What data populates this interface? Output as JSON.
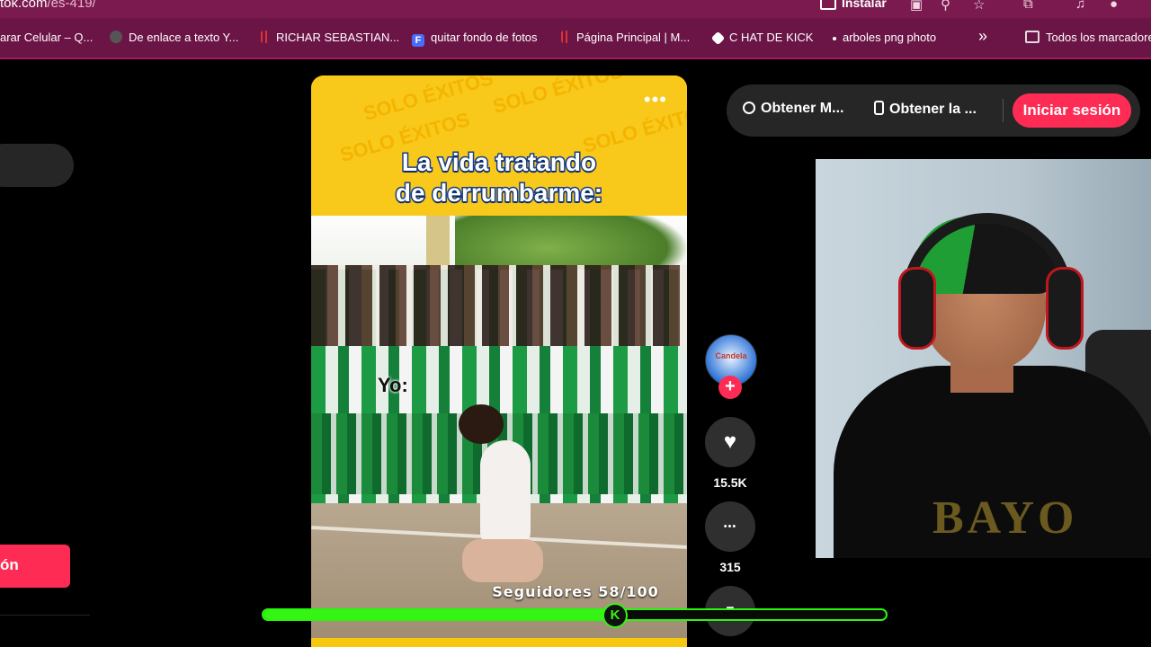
{
  "browser": {
    "url_domain": "tok.com",
    "url_path": "/es-419/",
    "install_label": "Instalar"
  },
  "bookmarks": [
    {
      "label": "arar Celular – Q...",
      "icon": "none"
    },
    {
      "label": "De enlace a texto Y...",
      "icon": "gear-icon"
    },
    {
      "label": "RICHAR SEBASTIAN...",
      "icon": "bars-icon"
    },
    {
      "label": "quitar fondo de fotos",
      "icon": "f-icon"
    },
    {
      "label": "Página Principal | M...",
      "icon": "bars-icon"
    },
    {
      "label": "C HAT DE KICK",
      "icon": "kick-icon"
    },
    {
      "label": "arboles png photo",
      "icon": "dot-icon"
    },
    {
      "label": "Todos los marcadores",
      "icon": "folder-icon"
    }
  ],
  "bookmarks_more": "»",
  "left": {
    "login_fragment": "ón"
  },
  "video": {
    "caption_line1": "La vida tratando",
    "caption_line2": "de derrumbarme:",
    "overlay_label": "Yo:",
    "watermark": "SOLO ÉXITOS",
    "menu_dots": "•••"
  },
  "actions": {
    "avatar_text": "Candela",
    "follow_symbol": "+",
    "likes": "15.5K",
    "comments": "315",
    "like_symbol": "♥",
    "comment_symbol": "•••",
    "saves_symbol": "■"
  },
  "topbar": {
    "get_music": "Obtener M...",
    "get_app": "Obtener la ...",
    "login": "Iniciar sesión"
  },
  "webcam": {
    "shirt_text": "BAYO"
  },
  "overlay": {
    "followers_label": "Seguidores 58/100",
    "followers_progress": 0.58,
    "badge_letter": "K",
    "accent_color": "#35f514"
  },
  "colors": {
    "tiktok_red": "#fe2c55",
    "browser_chrome": "#6b1446"
  }
}
